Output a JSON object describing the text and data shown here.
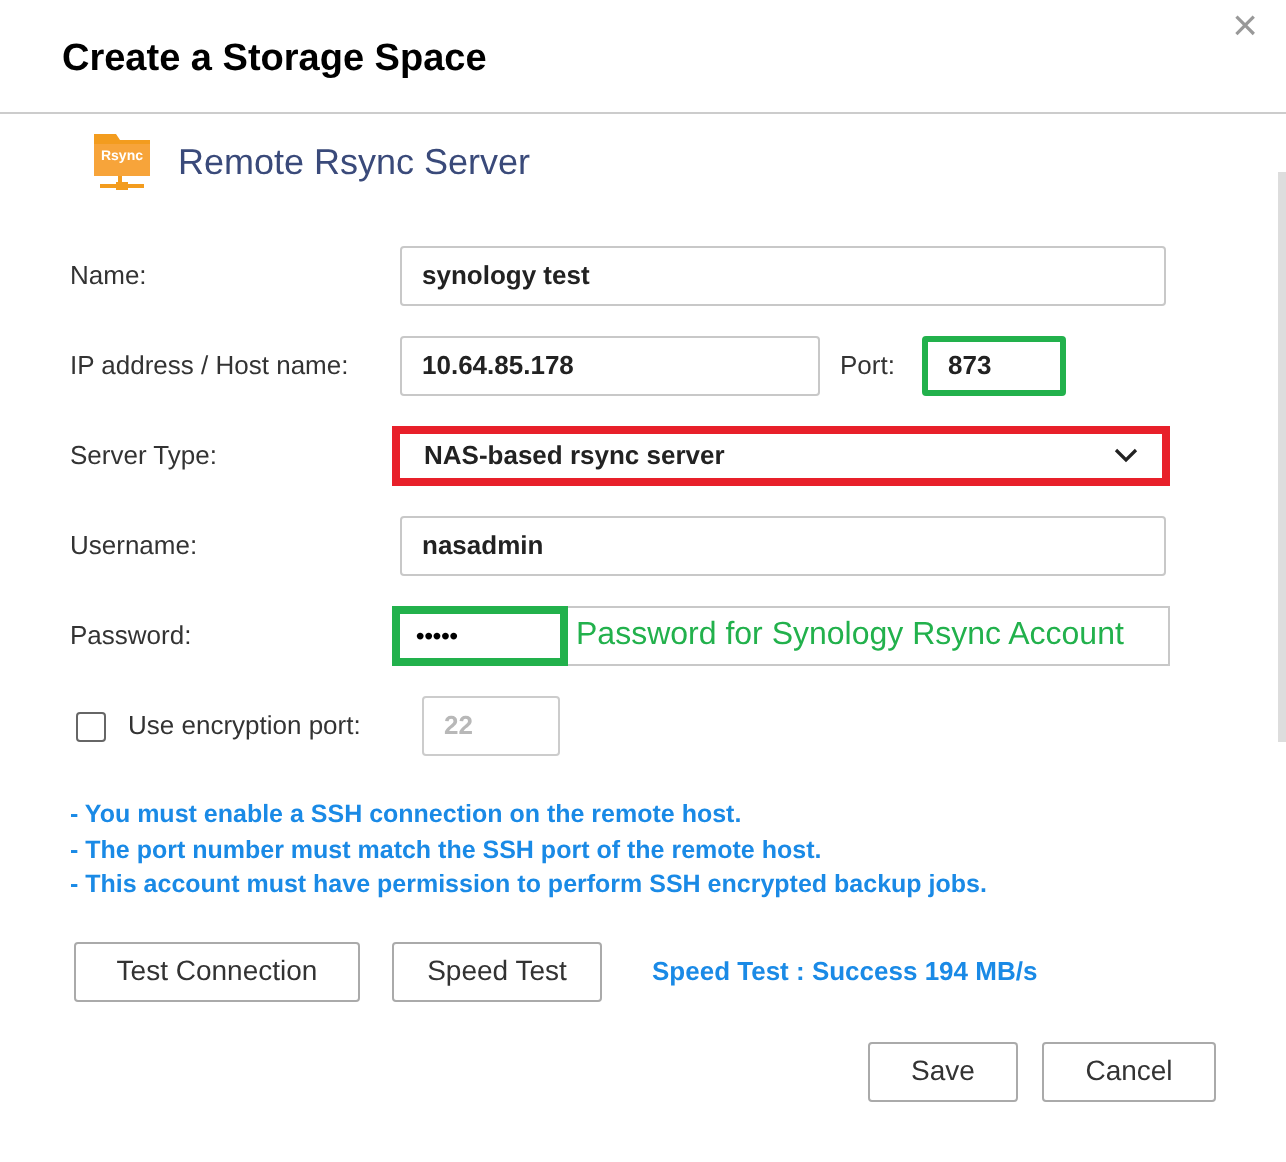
{
  "dialog": {
    "title": "Create a Storage Space",
    "close": "×"
  },
  "section": {
    "icon_text": "Rsync",
    "title": "Remote Rsync Server"
  },
  "form": {
    "name": {
      "label": "Name:",
      "value": "synology test"
    },
    "host": {
      "label": "IP address / Host name:",
      "value": "10.64.85.178"
    },
    "port": {
      "label": "Port:",
      "value": "873",
      "color": "#22b14c"
    },
    "server_type": {
      "label": "Server Type:",
      "value": "NAS-based rsync server",
      "color": "#e8202a"
    },
    "username": {
      "label": "Username:",
      "value": "nasadmin"
    },
    "password": {
      "label": "Password:",
      "value": "•••••",
      "color": "#22b14c",
      "annotation": "Password for Synology Rsync Account"
    },
    "encryption": {
      "label": "Use encryption port:",
      "checked": false,
      "port": "22",
      "disabled": true
    }
  },
  "notes": [
    "- You must enable a SSH connection on the remote host.",
    "- The port number must match the SSH port of the remote host.",
    "- This account must have permission to perform SSH encrypted backup jobs."
  ],
  "test_buttons": [
    "Test Connection",
    "Speed Test"
  ],
  "speed_result": "Speed Test : Success 194 MB/s",
  "buttons": [
    "Save",
    "Cancel"
  ]
}
